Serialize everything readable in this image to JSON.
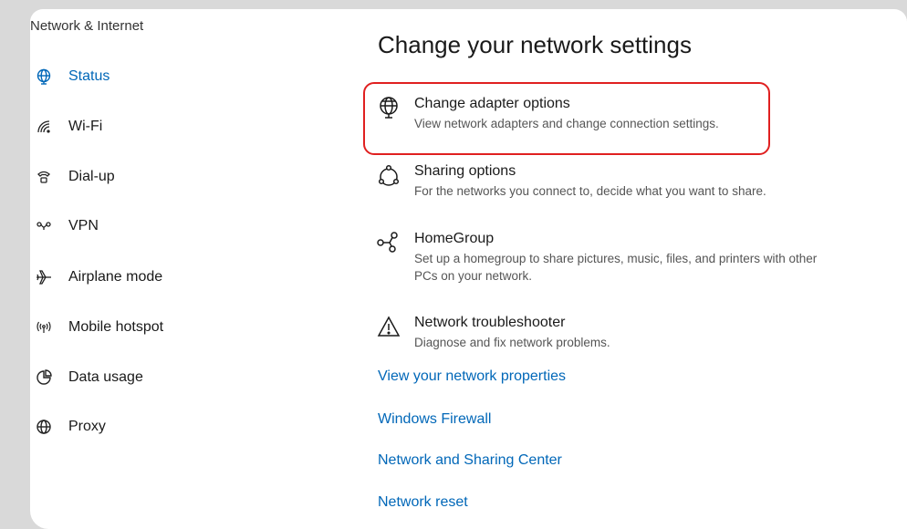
{
  "sidebar": {
    "title": "Network & Internet",
    "items": [
      {
        "label": "Status",
        "icon": "status-globe-icon",
        "active": true
      },
      {
        "label": "Wi-Fi",
        "icon": "wifi-icon"
      },
      {
        "label": "Dial-up",
        "icon": "dialup-phone-icon"
      },
      {
        "label": "VPN",
        "icon": "vpn-icon"
      },
      {
        "label": "Airplane mode",
        "icon": "airplane-icon"
      },
      {
        "label": "Mobile hotspot",
        "icon": "hotspot-icon"
      },
      {
        "label": "Data usage",
        "icon": "pie-chart-icon"
      },
      {
        "label": "Proxy",
        "icon": "globe-icon"
      }
    ]
  },
  "main": {
    "title": "Change your network settings",
    "options": [
      {
        "title": "Change adapter options",
        "desc": "View network adapters and change connection settings.",
        "icon": "adapter-globe-icon"
      },
      {
        "title": "Sharing options",
        "desc": "For the networks you connect to, decide what you want to share.",
        "icon": "sharing-icon"
      },
      {
        "title": "HomeGroup",
        "desc": "Set up a homegroup to share pictures, music, files, and printers with other PCs on your network.",
        "icon": "homegroup-icon"
      },
      {
        "title": "Network troubleshooter",
        "desc": "Diagnose and fix network problems.",
        "icon": "warning-icon"
      }
    ],
    "links": [
      "View your network properties",
      "Windows Firewall",
      "Network and Sharing Center",
      "Network reset"
    ]
  },
  "colors": {
    "accent": "#0067b8",
    "highlight": "#e02020"
  }
}
